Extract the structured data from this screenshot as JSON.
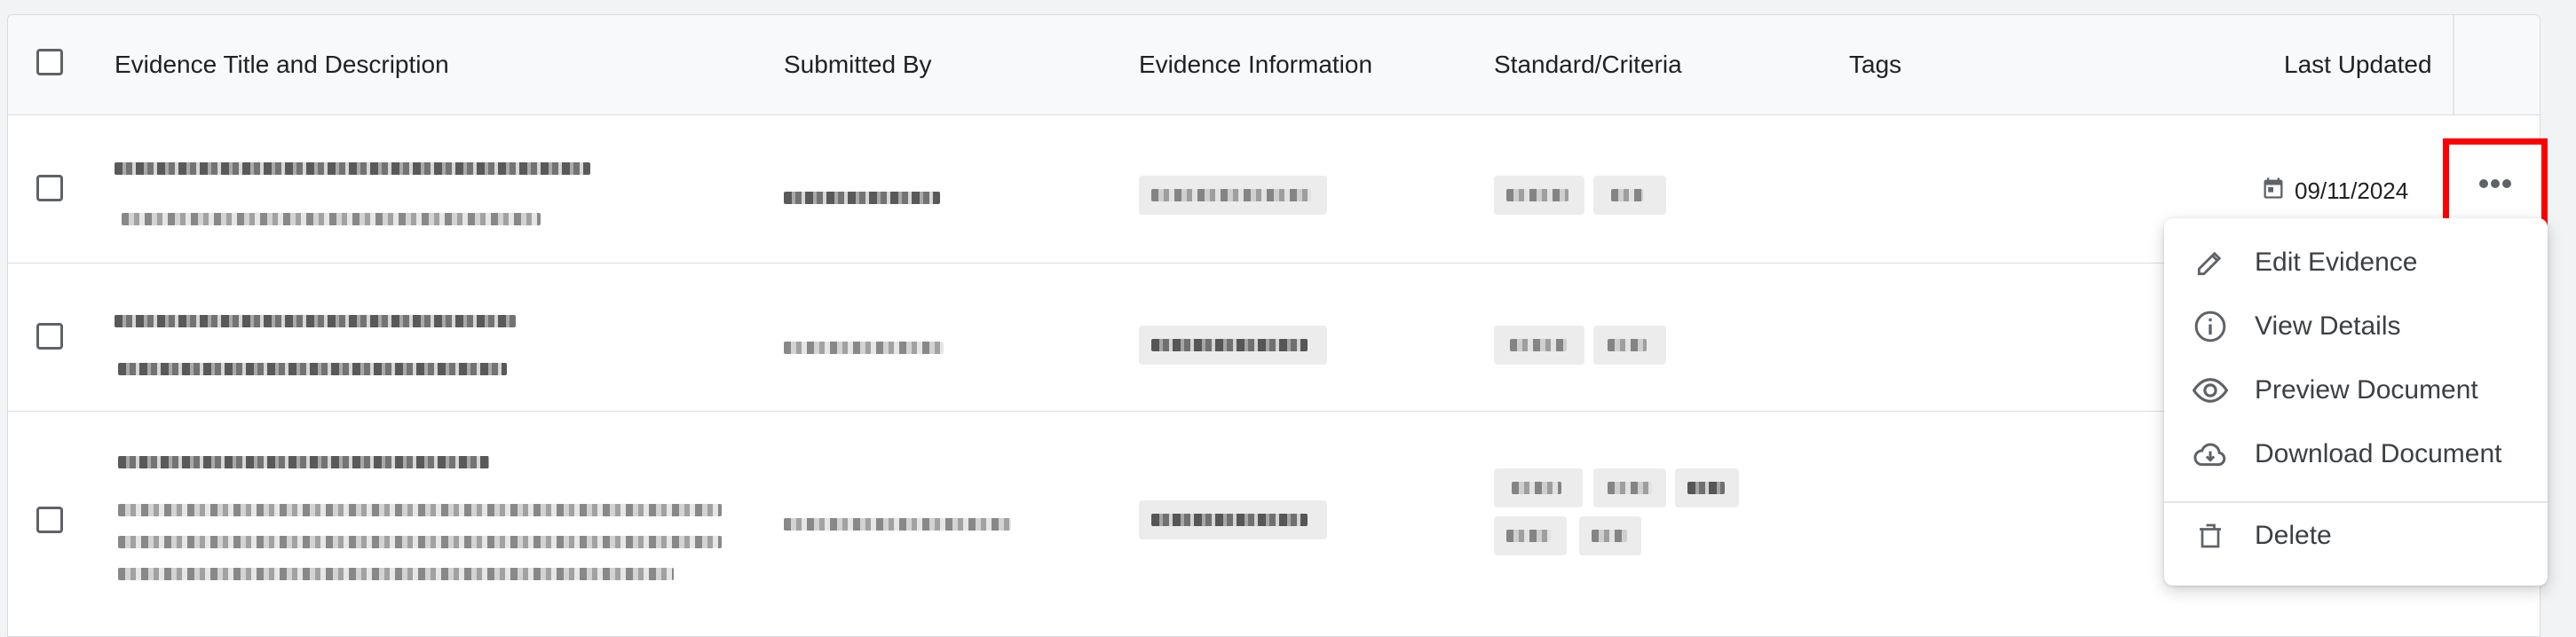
{
  "table": {
    "headers": {
      "title": "Evidence Title and Description",
      "submitted_by": "Submitted By",
      "evidence_info": "Evidence Information",
      "standard": "Standard/Criteria",
      "tags": "Tags",
      "last_updated": "Last Updated"
    },
    "rows": [
      {
        "last_updated": "09/11/2024"
      }
    ]
  },
  "action_menu": {
    "items": [
      {
        "label": "Edit Evidence",
        "icon": "pencil-icon"
      },
      {
        "label": "View Details",
        "icon": "info-icon"
      },
      {
        "label": "Preview Document",
        "icon": "eye-icon"
      },
      {
        "label": "Download Document",
        "icon": "cloud-download-icon"
      },
      {
        "label": "Delete",
        "icon": "trash-icon"
      }
    ]
  },
  "colors": {
    "highlight": "#ff0000",
    "header_bg": "#f8f9fb",
    "chip_bg": "#ececec"
  }
}
